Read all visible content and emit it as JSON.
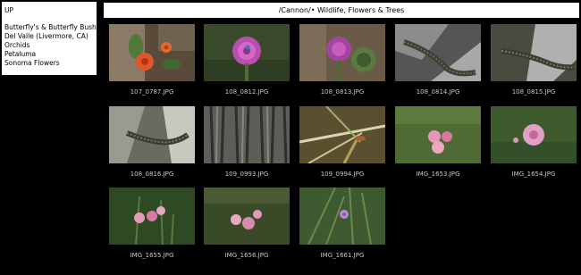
{
  "sidebar": {
    "up_label": "UP",
    "links": [
      "Butterfly's & Butterfly Bush",
      "Del Valle (Livermore, CA)",
      "Orchids",
      "Petaluma",
      "Sonoma Flowers"
    ]
  },
  "header": {
    "title": "/Cannon/• Wildlife, Flowers & Trees"
  },
  "gallery": {
    "items": [
      {
        "filename": "107_0787.JPG",
        "subject": "orange-flowers"
      },
      {
        "filename": "108_0812.JPG",
        "subject": "purple-thistle"
      },
      {
        "filename": "108_0813.JPG",
        "subject": "purple-thistle"
      },
      {
        "filename": "108_0814.JPG",
        "subject": "lizard-on-rock"
      },
      {
        "filename": "108_0815.JPG",
        "subject": "lizard-on-rock"
      },
      {
        "filename": "108_0816.JPG",
        "subject": "lizard-on-rock"
      },
      {
        "filename": "109_0993.JPG",
        "subject": "tree-bark"
      },
      {
        "filename": "109_0994.JPG",
        "subject": "grass-blades"
      },
      {
        "filename": "IMG_1653.JPG",
        "subject": "pink-flowers"
      },
      {
        "filename": "IMG_1654.JPG",
        "subject": "pink-flowers"
      },
      {
        "filename": "IMG_1655.JPG",
        "subject": "pink-flowers"
      },
      {
        "filename": "IMG_1656.JPG",
        "subject": "pink-flowers"
      },
      {
        "filename": "IMG_1661.JPG",
        "subject": "small-purple-flower"
      }
    ]
  }
}
